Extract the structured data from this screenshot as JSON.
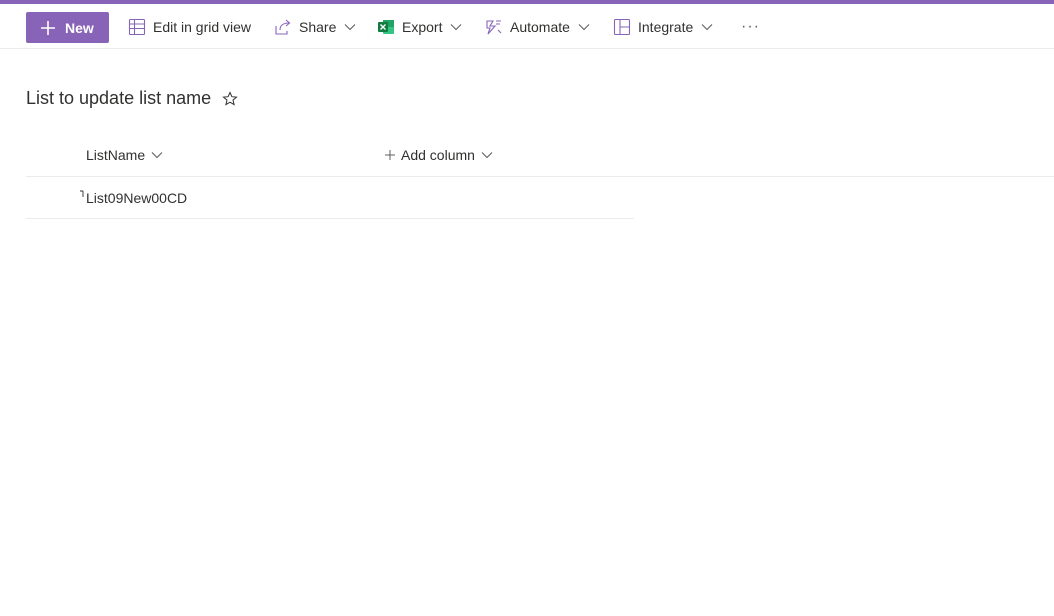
{
  "theme": {
    "accent": "#8764b8",
    "excel_green": "#217346",
    "text": "#323130",
    "border": "#edebe9"
  },
  "command_bar": {
    "new_label": "New",
    "edit_grid_label": "Edit in grid view",
    "share_label": "Share",
    "export_label": "Export",
    "automate_label": "Automate",
    "integrate_label": "Integrate",
    "more_label": "···",
    "icons": {
      "new": "plus-icon",
      "edit_grid": "grid-icon",
      "share": "share-icon",
      "export": "excel-icon",
      "automate": "automate-icon",
      "integrate": "integrate-icon"
    }
  },
  "list": {
    "title": "List to update list name",
    "columns": [
      {
        "label": "ListName"
      },
      {
        "label": "Add column"
      }
    ],
    "rows": [
      {
        "ListName": "List09New00CD"
      }
    ]
  }
}
